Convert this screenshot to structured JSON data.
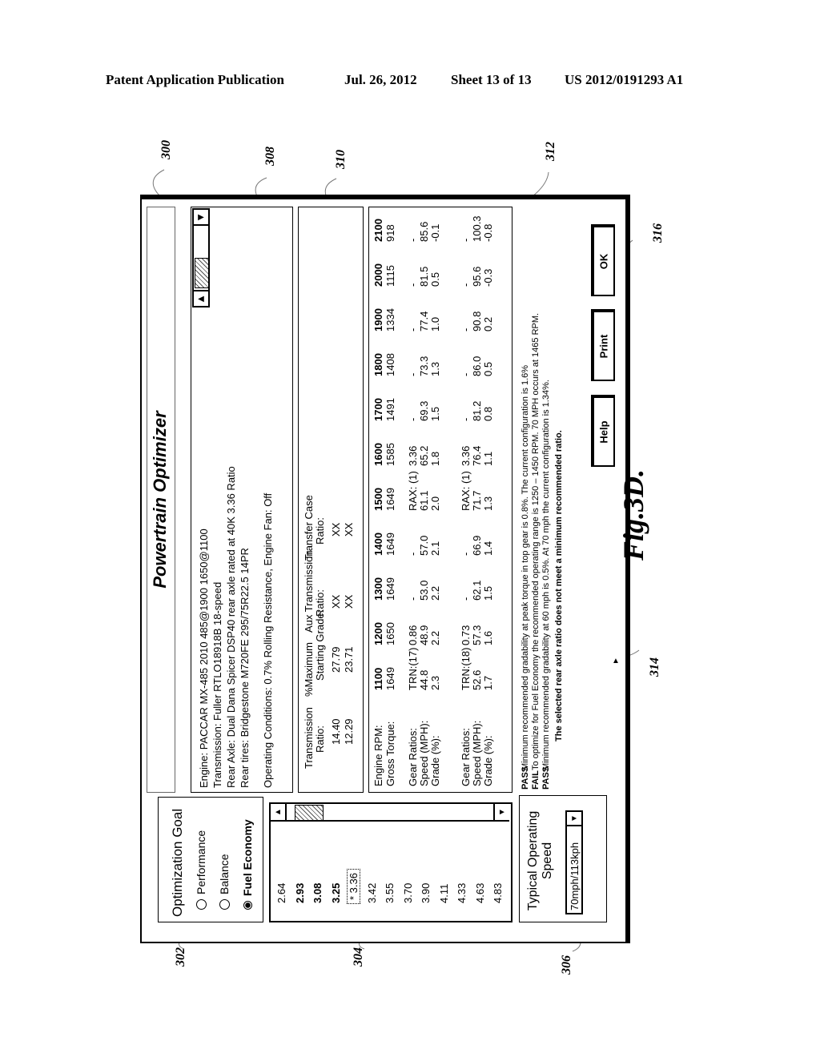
{
  "header": {
    "publication": "Patent Application Publication",
    "date": "Jul. 26, 2012",
    "sheet": "Sheet 13 of 13",
    "number": "US 2012/0191293 A1"
  },
  "figure_label": "Fig.3D.",
  "reference_numerals": [
    "300",
    "302",
    "304",
    "306",
    "308",
    "310",
    "312",
    "314",
    "316"
  ],
  "dialog": {
    "title": "Powertrain Optimizer",
    "optimization_goal": {
      "heading": "Optimization Goal",
      "options": [
        {
          "label": "Performance",
          "selected": false
        },
        {
          "label": "Balance",
          "selected": false
        },
        {
          "label": "Fuel Economy",
          "selected": true
        }
      ]
    },
    "axle_ratios": {
      "items": [
        {
          "label": "2.64",
          "bold": false,
          "current": false
        },
        {
          "label": "2.93",
          "bold": true,
          "current": false
        },
        {
          "label": "3.08",
          "bold": true,
          "current": false
        },
        {
          "label": "3.25",
          "bold": true,
          "current": false
        },
        {
          "label": "* 3.36",
          "bold": false,
          "current": true
        },
        {
          "label": "3.42",
          "bold": false,
          "current": false
        },
        {
          "label": "3.55",
          "bold": false,
          "current": false
        },
        {
          "label": "3.70",
          "bold": false,
          "current": false
        },
        {
          "label": "3.90",
          "bold": false,
          "current": false
        },
        {
          "label": "4.11",
          "bold": false,
          "current": false
        },
        {
          "label": "4.33",
          "bold": false,
          "current": false
        },
        {
          "label": "4.63",
          "bold": false,
          "current": false
        },
        {
          "label": "4.83",
          "bold": false,
          "current": false
        }
      ]
    },
    "operating_speed": {
      "heading_line1": "Typical Operating",
      "heading_line2": "Speed",
      "selected": "70mph/113kph"
    },
    "config": {
      "engine": "Engine:  PACCAR MX-485 2010 485@1900 1650@1100",
      "transmission": "Transmission:  Fuller RTLO18918B 18-speed",
      "rear_axle": "Rear Axle:  Dual Dana Spicer DSP40 rear axle rated at 40K  3.36 Ratio",
      "rear_tires": "Rear tires: Bridgestone M720FE 295/75R22.5 14PR",
      "operating_conditions": "Operating Conditions: 0.7% Rolling Resistance, Engine Fan: Off"
    },
    "ratio_table": {
      "headers": [
        [
          "Transmission",
          "Ratio:"
        ],
        [
          "%Maximum",
          "Starting Grade:"
        ],
        [
          "Aux Transmission",
          "Ratio:"
        ],
        [
          "Transfer Case",
          "Ratio:"
        ]
      ],
      "rows": [
        [
          "14.40",
          "27.79",
          "XX",
          "XX"
        ],
        [
          "12.29",
          "23.71",
          "XX",
          "XX"
        ]
      ]
    },
    "performance_table": {
      "rpm_label": "Engine RPM:",
      "torque_label": "Gross Torque:",
      "rpm": [
        "1100",
        "1200",
        "1300",
        "1400",
        "1500",
        "1600",
        "1700",
        "1800",
        "1900",
        "2000",
        "2100"
      ],
      "torque": [
        "1649",
        "1650",
        "1649",
        "1649",
        "1649",
        "1585",
        "1491",
        "1408",
        "1334",
        "1115",
        "918"
      ],
      "blocks": [
        {
          "gear_label": "Gear Ratios:",
          "speed_label": "Speed (MPH):",
          "grade_label": "Grade (%):",
          "gear": [
            "TRN:(17)",
            "0.86",
            "-",
            "-",
            "RAX: (1)",
            "3.36",
            "-",
            "-",
            "-",
            "-",
            "-"
          ],
          "speed": [
            "44.8",
            "48.9",
            "53.0",
            "57.0",
            "61.1",
            "65.2",
            "69.3",
            "73.3",
            "77.4",
            "81.5",
            "85.6"
          ],
          "grade": [
            "2.3",
            "2.2",
            "2.2",
            "2.1",
            "2.0",
            "1.8",
            "1.5",
            "1.3",
            "1.0",
            "0.5",
            "-0.1"
          ]
        },
        {
          "gear_label": "Gear Ratios:",
          "speed_label": "Speed (MPH):",
          "grade_label": "Grade (%):",
          "gear": [
            "TRN:(18)",
            "0.73",
            "-",
            "-",
            "RAX: (1)",
            "3.36",
            "-",
            "-",
            "-",
            "-",
            "-"
          ],
          "speed": [
            "52.6",
            "57.3",
            "62.1",
            "66.9",
            "71.7",
            "76.4",
            "81.2",
            "86.0",
            "90.8",
            "95.6",
            "100.3"
          ],
          "grade": [
            "1.7",
            "1.6",
            "1.5",
            "1.4",
            "1.3",
            "1.1",
            "0.8",
            "0.5",
            "0.2",
            "-0.3",
            "-0.8"
          ]
        }
      ]
    },
    "messages": [
      {
        "status": "PASS",
        "text": "Minimum recommended gradability at peak torque in top gear is 0.8%. The current configuration is 1.6%"
      },
      {
        "status": "FAIL",
        "text": "To optimize for Fuel Economy the recommended operating range is 1250 – 1450 RPM.  70 MPH occurs at 1465 RPM."
      },
      {
        "status": "PASS",
        "text": "Minimum recommended gradability at 60 mph is 0.5%.  At 70 mph the current configuration is 1.34%."
      }
    ],
    "summary": "The selected rear axle ratio does not meet a minimum recommended ratio.",
    "buttons": {
      "help": "Help",
      "print": "Print",
      "ok": "OK"
    }
  }
}
